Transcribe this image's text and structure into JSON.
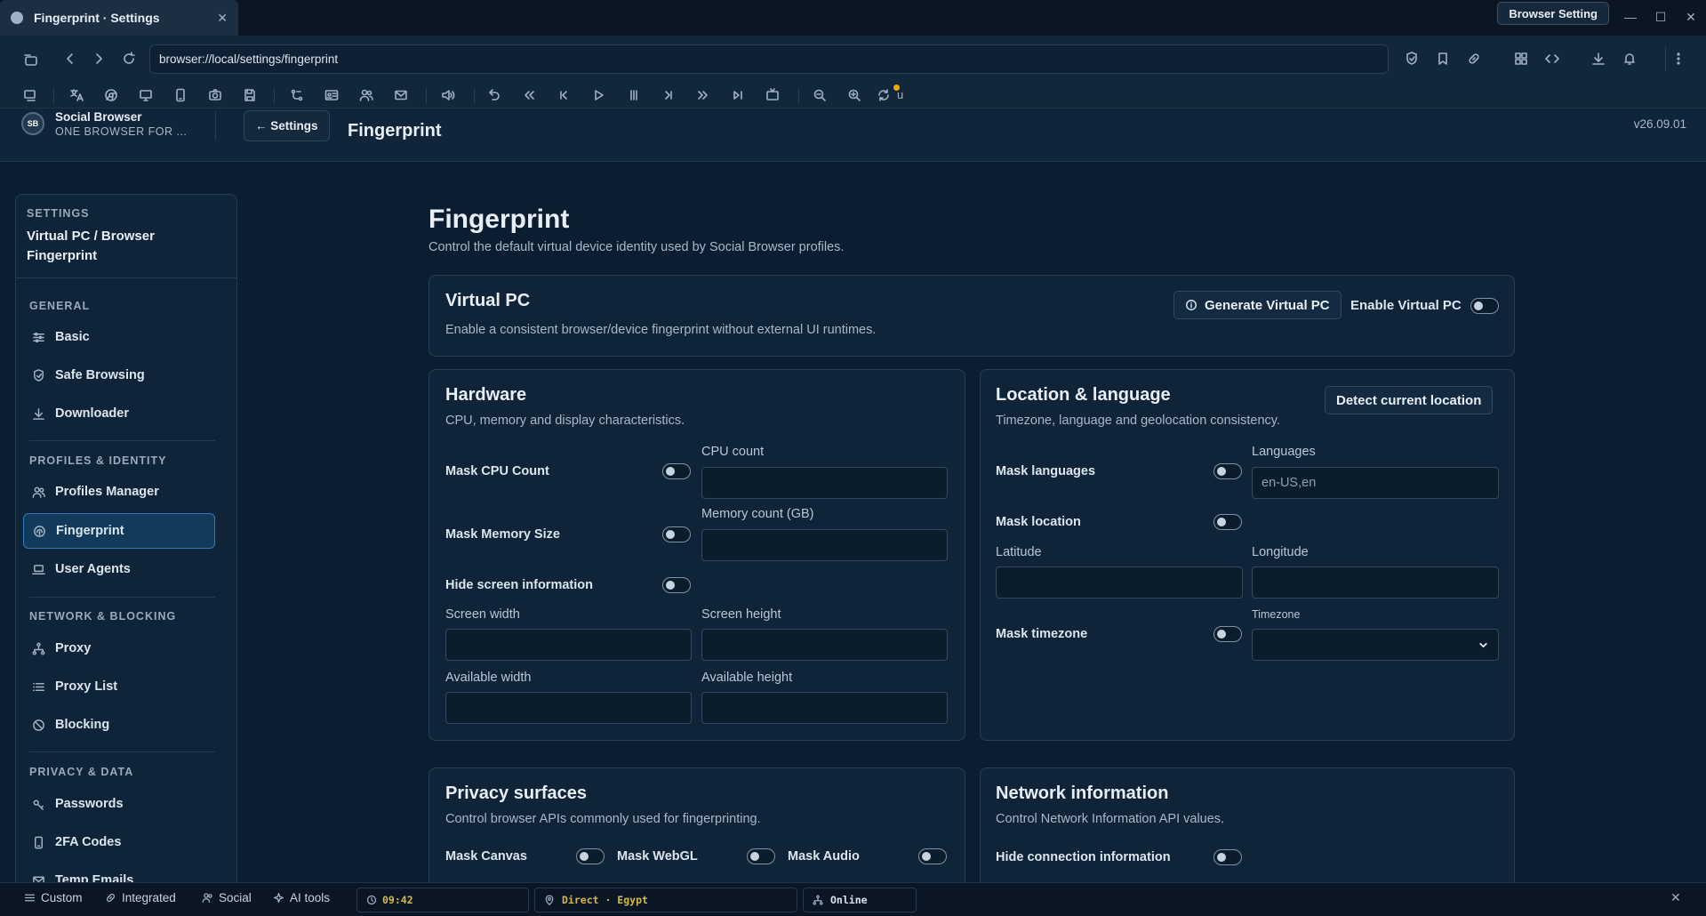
{
  "browser": {
    "tab_title": "Fingerprint · Settings",
    "setting_button": "Browser Setting",
    "url": "browser://local/settings/fingerprint"
  },
  "header": {
    "brand_name": "Social Browser",
    "brand_tagline": "ONE BROWSER FOR ...",
    "logo_text": "SB",
    "settings_button": "← Settings",
    "title": "Fingerprint",
    "version": "v26.09.01"
  },
  "sidebar": {
    "heading_small": "SETTINGS",
    "heading_large": "Virtual PC / Browser Fingerprint",
    "sections": [
      {
        "title": "GENERAL",
        "items": [
          "Basic",
          "Safe Browsing",
          "Downloader"
        ]
      },
      {
        "title": "PROFILES & IDENTITY",
        "items": [
          "Profiles Manager",
          "Fingerprint",
          "User Agents"
        ]
      },
      {
        "title": "NETWORK & BLOCKING",
        "items": [
          "Proxy",
          "Proxy List",
          "Blocking"
        ]
      },
      {
        "title": "PRIVACY & DATA",
        "items": [
          "Passwords",
          "2FA Codes",
          "Temp Emails"
        ]
      }
    ],
    "active_item": "Fingerprint"
  },
  "page": {
    "title": "Fingerprint",
    "subtitle": "Control the default virtual device identity used by Social Browser profiles."
  },
  "virtual_pc": {
    "title": "Virtual PC",
    "subtitle": "Enable a consistent browser/device fingerprint without external UI runtimes.",
    "generate_button": "Generate Virtual PC",
    "enable_label": "Enable Virtual PC",
    "enabled": false
  },
  "hardware": {
    "title": "Hardware",
    "subtitle": "CPU, memory and display characteristics.",
    "mask_cpu": "Mask CPU Count",
    "cpu_count_label": "CPU count",
    "cpu_count_value": "",
    "mask_memory": "Mask Memory Size",
    "memory_label": "Memory count (GB)",
    "memory_value": "",
    "hide_screen": "Hide screen information",
    "screen_width": "Screen width",
    "screen_height": "Screen height",
    "available_width": "Available width",
    "available_height": "Available height"
  },
  "location": {
    "title": "Location & language",
    "subtitle": "Timezone, language and geolocation consistency.",
    "detect_button": "Detect current location",
    "mask_languages": "Mask languages",
    "languages_label": "Languages",
    "languages_placeholder": "en-US,en",
    "mask_location": "Mask location",
    "latitude": "Latitude",
    "longitude": "Longitude",
    "mask_timezone": "Mask timezone",
    "timezone_label": "Timezone",
    "timezone_value": ""
  },
  "privacy": {
    "title": "Privacy surfaces",
    "subtitle": "Control browser APIs commonly used for fingerprinting.",
    "mask_canvas": "Mask Canvas",
    "mask_webgl": "Mask WebGL",
    "mask_audio": "Mask Audio"
  },
  "network": {
    "title": "Network information",
    "subtitle": "Control Network Information API values.",
    "hide_connection": "Hide connection information"
  },
  "statusbar": {
    "custom": "Custom",
    "integrated": "Integrated",
    "social": "Social",
    "ai_tools": "AI tools",
    "time": "09:42",
    "connection": "Direct · Egypt",
    "online": "Online"
  },
  "colors": {
    "background": "#0b1e30",
    "card": "#0f2438",
    "accent": "#2e7ab8",
    "connection_text": "#d4b94a",
    "online_text": "#dbe5ee",
    "notification_dot": "#f0a500"
  }
}
